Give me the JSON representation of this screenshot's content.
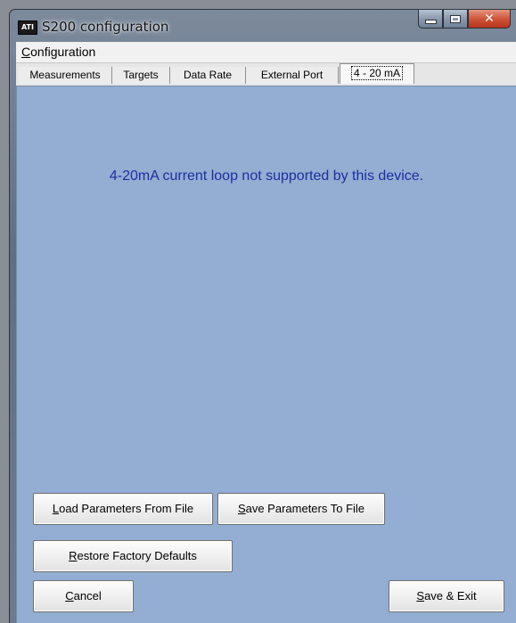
{
  "window": {
    "title": "S200 configuration",
    "icon_label": "ATI",
    "controls": {
      "minimize": "minimize-icon",
      "maximize": "maximize-icon",
      "close": "✕"
    }
  },
  "menu": {
    "items": [
      {
        "label": "Configuration",
        "accel": "C",
        "rest": "onfiguration"
      }
    ]
  },
  "tabs": [
    {
      "label": "Measurements",
      "active": false
    },
    {
      "label": "Targets",
      "active": false
    },
    {
      "label": "Data Rate",
      "active": false
    },
    {
      "label": "External Port",
      "active": false
    },
    {
      "label": "4 - 20 mA",
      "active": true
    }
  ],
  "panel": {
    "message": "4-20mA current loop not supported by this device."
  },
  "buttons": {
    "load": {
      "accel": "L",
      "rest": "oad Parameters From File"
    },
    "save_to_file": {
      "accel": "S",
      "rest": "ave Parameters To File"
    },
    "restore": {
      "accel": "R",
      "rest": "estore Factory Defaults"
    },
    "cancel": {
      "accel": "C",
      "rest": "ancel"
    },
    "save_exit": {
      "accel": "S",
      "rest": "ave & Exit"
    }
  },
  "colors": {
    "panel_bg": "#93add3",
    "message_text": "#1d2fa0",
    "close_button": "#c9462b"
  }
}
